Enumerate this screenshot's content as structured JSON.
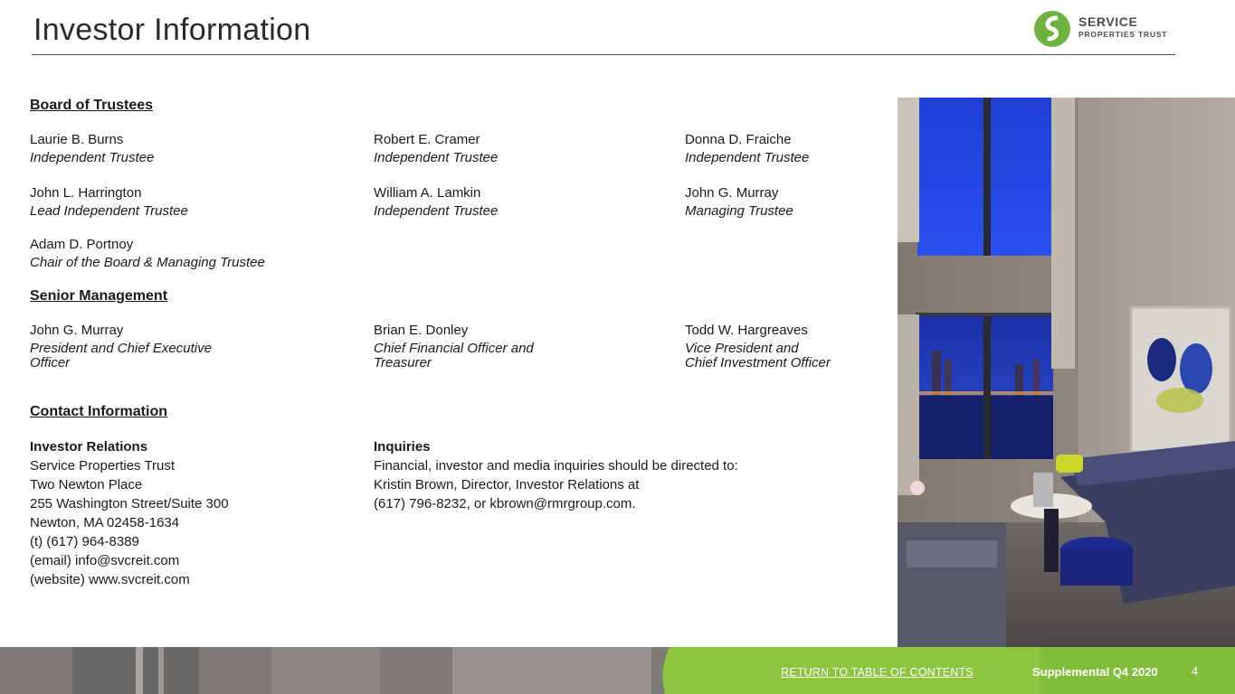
{
  "header": {
    "title": "Investor Information",
    "logo_line1": "SERVICE",
    "logo_line2": "PROPERTIES TRUST",
    "logo_color": "#6cb33f"
  },
  "board": {
    "heading": "Board of Trustees",
    "members": [
      {
        "name": "Laurie B. Burns",
        "role": "Independent Trustee"
      },
      {
        "name": "Robert E. Cramer",
        "role": "Independent Trustee"
      },
      {
        "name": "Donna D. Fraiche",
        "role": "Independent Trustee"
      },
      {
        "name": "John L. Harrington",
        "role": "Lead Independent Trustee"
      },
      {
        "name": "William A. Lamkin",
        "role": "Independent Trustee"
      },
      {
        "name": "John G. Murray",
        "role": "Managing Trustee"
      },
      {
        "name": "Adam D. Portnoy",
        "role": "Chair of the Board & Managing Trustee"
      }
    ]
  },
  "management": {
    "heading": "Senior Management",
    "members": [
      {
        "name": "John G. Murray",
        "role_line1": "President and Chief Executive",
        "role_line2": "Officer"
      },
      {
        "name": "Brian E. Donley",
        "role_line1": "Chief Financial Officer and",
        "role_line2": "Treasurer"
      },
      {
        "name": "Todd W. Hargreaves",
        "role_line1": "Vice President and",
        "role_line2": "Chief Investment Officer"
      }
    ]
  },
  "contact": {
    "heading": "Contact Information",
    "investor_relations": {
      "heading": "Investor Relations",
      "lines": [
        "Service Properties Trust",
        "Two Newton Place",
        "255 Washington Street/Suite 300",
        "Newton, MA  02458-1634",
        "(t) (617) 964-8389",
        "(email) info@svcreit.com",
        "(website) www.svcreit.com"
      ]
    },
    "inquiries": {
      "heading": "Inquiries",
      "lines": [
        "Financial, investor and media inquiries should be directed to:",
        "Kristin Brown, Director, Investor Relations at",
        "(617) 796-8232, or kbrown@rmrgroup.com."
      ]
    }
  },
  "footer": {
    "return_link": "RETURN TO TABLE OF CONTENTS",
    "supplemental": "Supplemental Q4 2020",
    "page_number": "4",
    "green": "#8cc63f"
  }
}
